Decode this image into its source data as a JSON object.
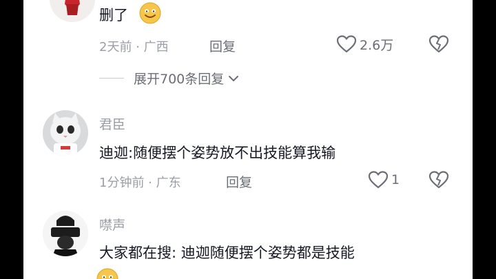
{
  "comments": [
    {
      "username": "",
      "text": "删了",
      "time": "2天前",
      "location": "广西",
      "reply_label": "回复",
      "likes": "2.6万",
      "expand_label": "展开700条回复",
      "emoji_icon": "grinning-face-icon"
    },
    {
      "username": "君臣",
      "text": "迪迦:随便摆个姿势放不出技能算我输",
      "time": "1分钟前",
      "location": "广东",
      "reply_label": "回复",
      "likes": "1"
    },
    {
      "username": "噤声",
      "text": "大家都在搜:  迪迦随便摆个姿势都是技能",
      "emoji_icon": "grinning-face-icon"
    }
  ],
  "meta_separator": " · ",
  "colors": {
    "text": "#161823",
    "meta": "#9b9ea4",
    "action": "#6b6e75",
    "emoji": "#f6c64a"
  }
}
